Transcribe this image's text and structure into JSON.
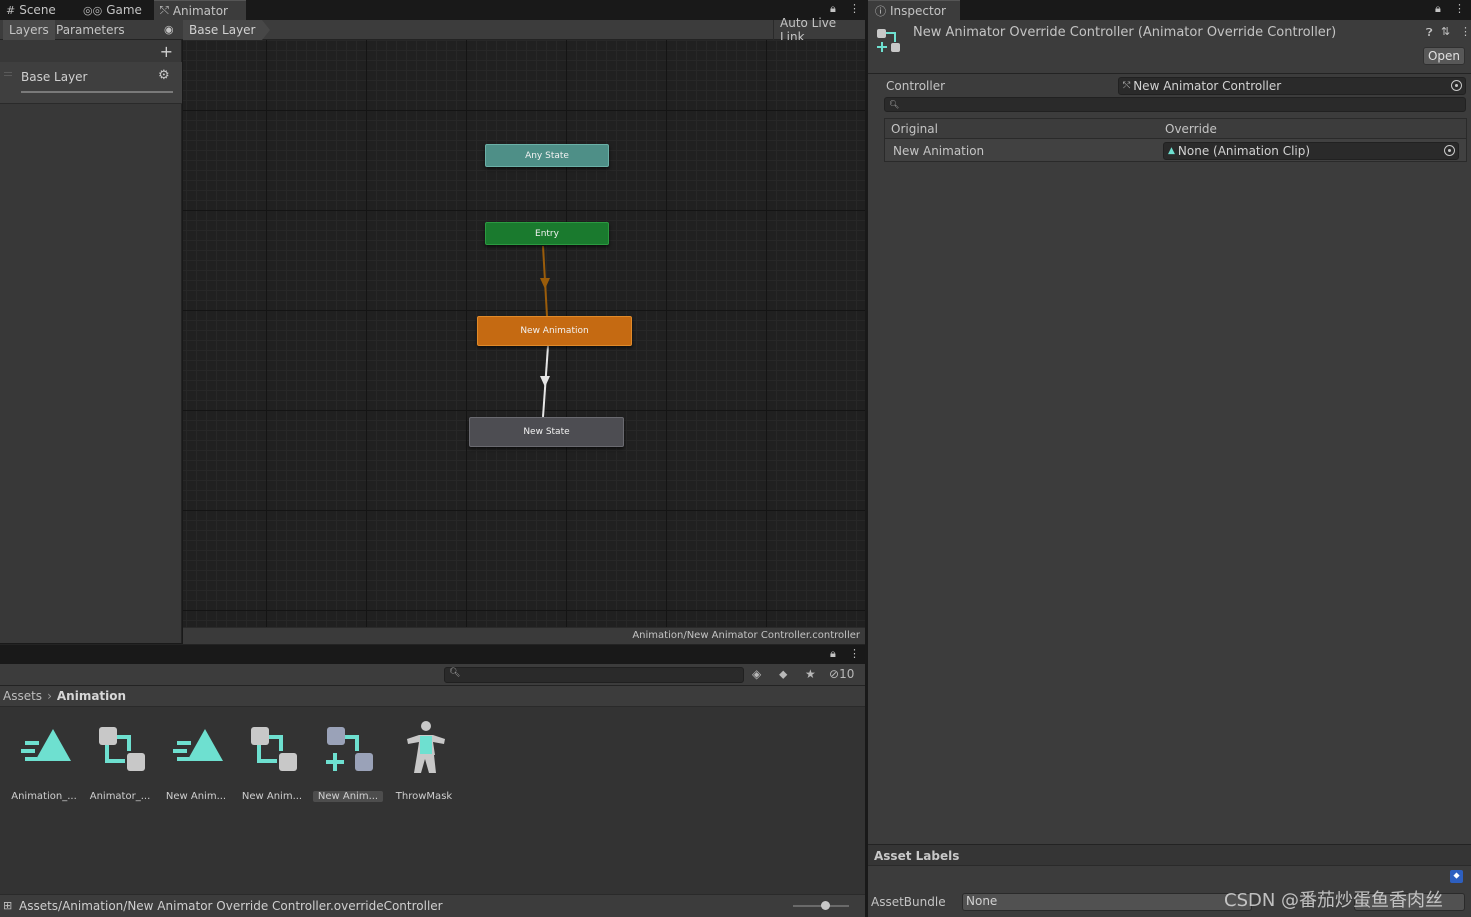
{
  "tabs": {
    "scene": "Scene",
    "game": "Game",
    "animator": "Animator",
    "inspector": "Inspector"
  },
  "animator": {
    "toolbar": {
      "layers": "Layers",
      "parameters": "Parameters",
      "breadcrumb": "Base Layer",
      "auto_live_link": "Auto Live Link"
    },
    "layers": [
      {
        "name": "Base Layer"
      }
    ],
    "states": {
      "any_state": "Any State",
      "entry": "Entry",
      "new_animation": "New Animation",
      "new_state": "New State"
    },
    "asset_path": "Animation/New Animator Controller.controller"
  },
  "project": {
    "breadcrumb": [
      "Assets",
      "Animation"
    ],
    "hidden_count": "10",
    "assets": [
      {
        "label": "Animation_...",
        "icon": "animation-clip-icon"
      },
      {
        "label": "Animator_...",
        "icon": "animator-controller-icon"
      },
      {
        "label": "New Anim...",
        "icon": "animation-clip-icon"
      },
      {
        "label": "New Anim...",
        "icon": "animator-controller-icon"
      },
      {
        "label": "New Anim...",
        "icon": "animator-override-controller-icon",
        "selected": true
      },
      {
        "label": "ThrowMask",
        "icon": "avatar-mask-icon"
      }
    ],
    "selected_path": "Assets/Animation/New Animator Override Controller.overrideController"
  },
  "inspector": {
    "title": "New Animator Override Controller (Animator Override Controller)",
    "open_button": "Open",
    "controller_label": "Controller",
    "controller_value": "New Animator Controller",
    "table": {
      "col_original": "Original",
      "col_override": "Override",
      "rows": [
        {
          "original": "New Animation",
          "override": "None (Animation Clip)"
        }
      ]
    },
    "asset_labels_title": "Asset Labels",
    "asset_bundle_label": "AssetBundle",
    "asset_bundle_value": "None"
  },
  "watermark": "CSDN @番茄炒蛋鱼香肉丝",
  "colors": {
    "any_state": "#4e8f87",
    "entry": "#1a7a2e",
    "new_animation": "#c56a12",
    "new_state": "#4d4d52",
    "accent_cyan": "#6ee0d0",
    "transition_orange": "#a0600a"
  }
}
